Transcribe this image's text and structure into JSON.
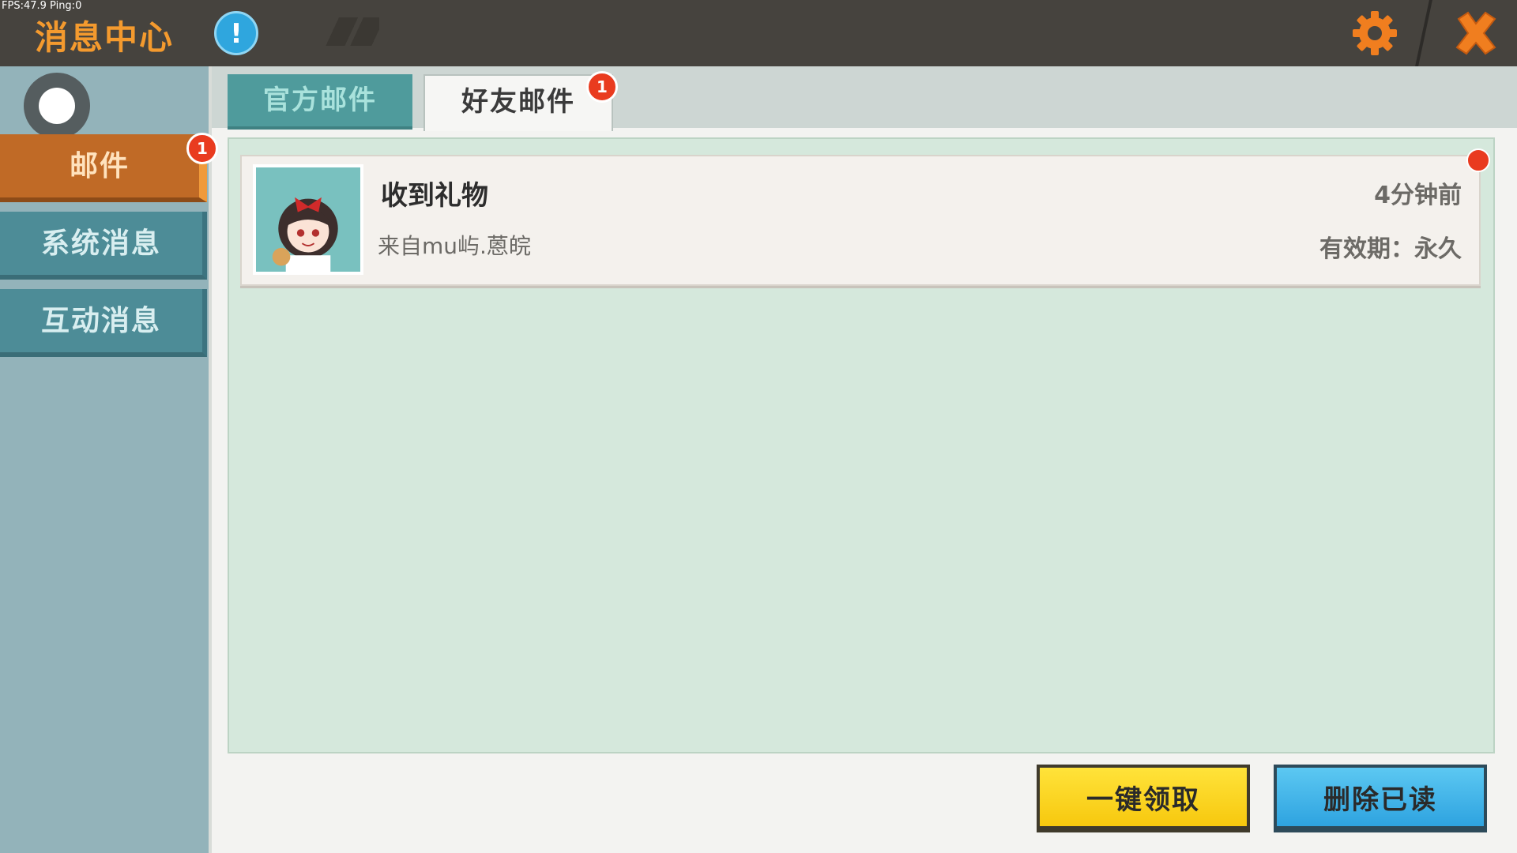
{
  "debug": {
    "fps_text": "FPS:47.9  Ping:0"
  },
  "header": {
    "title": "消息中心",
    "info_icon": "exclamation-icon",
    "info_symbol": "!",
    "settings_icon": "gear-icon",
    "close_icon": "close-icon"
  },
  "sidebar": {
    "items": [
      {
        "label": "邮件",
        "active": true,
        "badge": "1"
      },
      {
        "label": "系统消息",
        "active": false
      },
      {
        "label": "互动消息",
        "active": false
      }
    ]
  },
  "tabs": [
    {
      "label": "官方邮件",
      "active": false
    },
    {
      "label": "好友邮件",
      "active": true,
      "badge": "1"
    }
  ],
  "mails": [
    {
      "title": "收到礼物",
      "from": "来自mu屿.蒽皖",
      "time": "4分钟前",
      "validity": "有效期：永久",
      "unread": true
    }
  ],
  "actions": {
    "claim_all": "一键领取",
    "delete_read": "删除已读"
  },
  "colors": {
    "header_bg": "#46433e",
    "title": "#f49a2e",
    "badge": "#e93b1f",
    "active_side": "#c06a26",
    "content_bg": "#d5e8dc",
    "claim_btn": "#ffe33a",
    "delete_btn": "#2ea3e0"
  }
}
